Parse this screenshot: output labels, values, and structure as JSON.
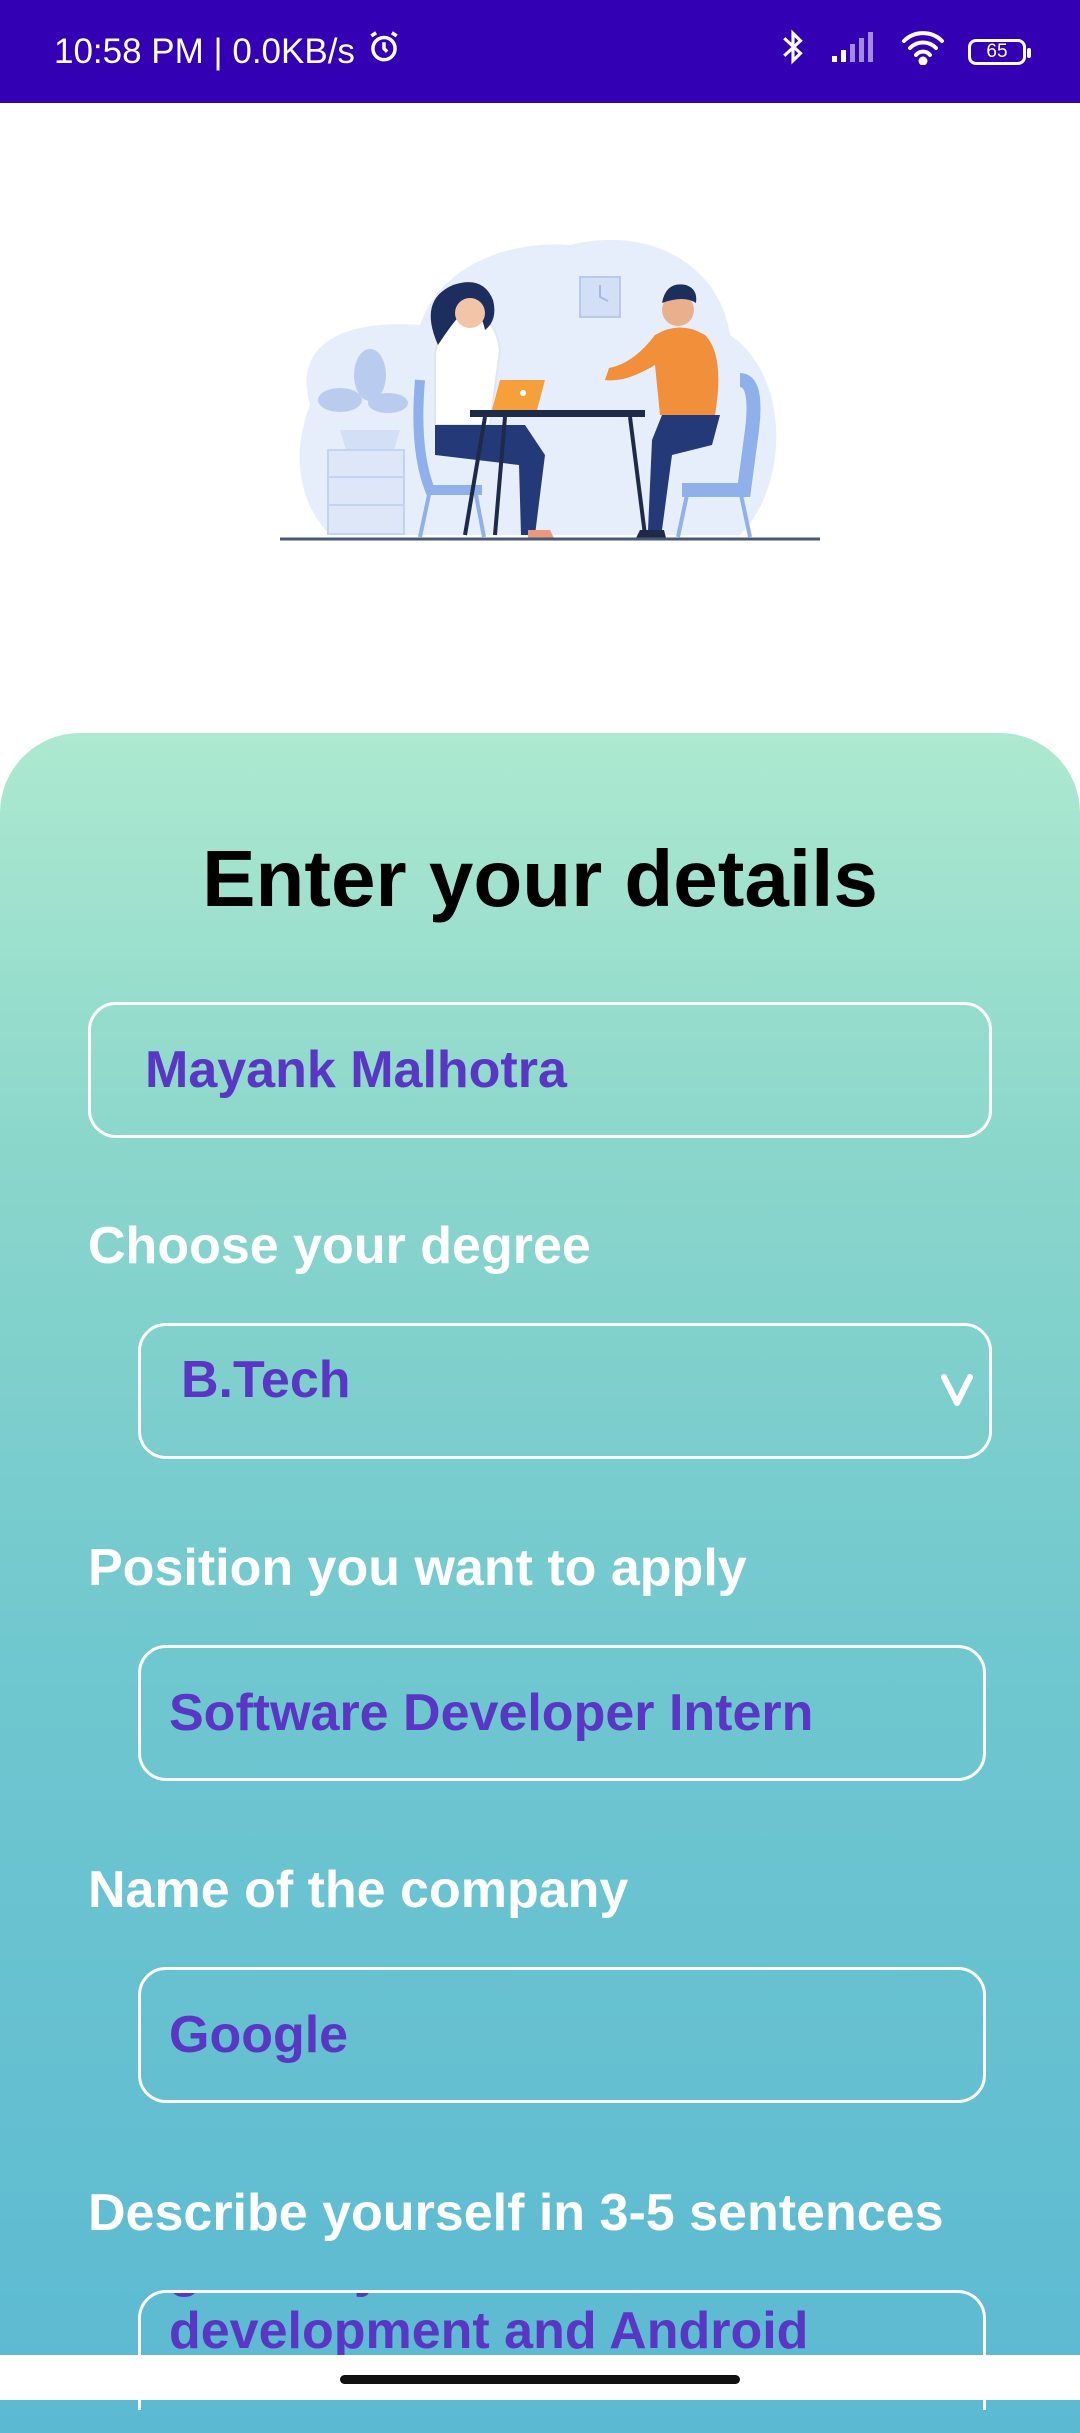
{
  "status_bar": {
    "time_speed": "10:58 PM | 0.0KB/s",
    "battery": "65"
  },
  "form": {
    "title": "Enter your details",
    "name_value": "Mayank Malhotra",
    "degree_label": "Choose your degree",
    "degree_value": "B.Tech",
    "position_label": "Position you want to apply",
    "position_value": "Software Developer Intern",
    "company_label": "Name of the company",
    "company_value": "Google",
    "describe_label": "Describe yourself in 3-5 sentences",
    "describe_value": "grow my skills in Software development and Android"
  },
  "colors": {
    "status_bar": "#3300b4",
    "input_text": "#5a36c4",
    "gradient_top": "#ade9d0",
    "gradient_bottom": "#5bb9d2"
  }
}
